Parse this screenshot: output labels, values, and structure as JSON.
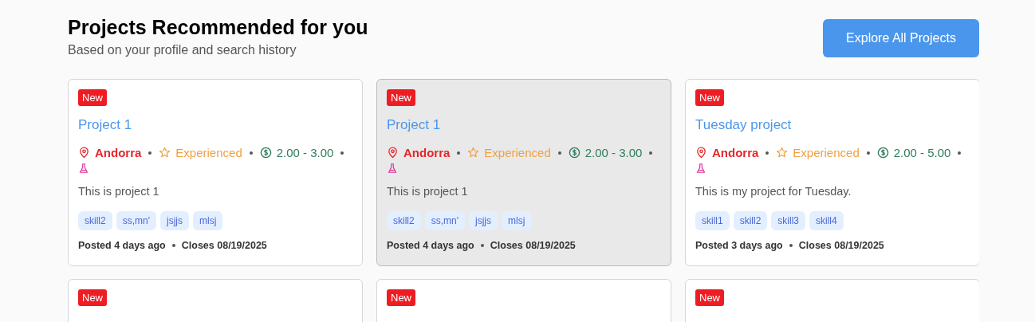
{
  "header": {
    "title": "Projects Recommended for you",
    "subtitle": "Based on your profile and search history",
    "button": "Explore All Projects"
  },
  "cards": [
    {
      "badge": "New",
      "hovered": false,
      "title": "Project 1",
      "location": "Andorra",
      "level": "Experienced",
      "budget": "2.00 - 3.00",
      "description": "This is project 1",
      "skills": [
        "skill2",
        "ss,mn'",
        "jsjjs",
        "mlsj"
      ],
      "posted": "Posted 4 days ago",
      "closes": "Closes 08/19/2025"
    },
    {
      "badge": "New",
      "hovered": true,
      "title": "Project 1",
      "location": "Andorra",
      "level": "Experienced",
      "budget": "2.00 - 3.00",
      "description": "This is project 1",
      "skills": [
        "skill2",
        "ss,mn'",
        "jsjjs",
        "mlsj"
      ],
      "posted": "Posted 4 days ago",
      "closes": "Closes 08/19/2025"
    },
    {
      "badge": "New",
      "hovered": false,
      "title": "Tuesday project",
      "location": "Andorra",
      "level": "Experienced",
      "budget": "2.00 - 5.00",
      "description": "This is my project for Tuesday.",
      "skills": [
        "skill1",
        "skill2",
        "skill3",
        "skill4"
      ],
      "posted": "Posted 3 days ago",
      "closes": "Closes 08/19/2025"
    },
    {
      "badge": "New",
      "hovered": false
    },
    {
      "badge": "New",
      "hovered": false
    },
    {
      "badge": "New",
      "hovered": false
    }
  ]
}
